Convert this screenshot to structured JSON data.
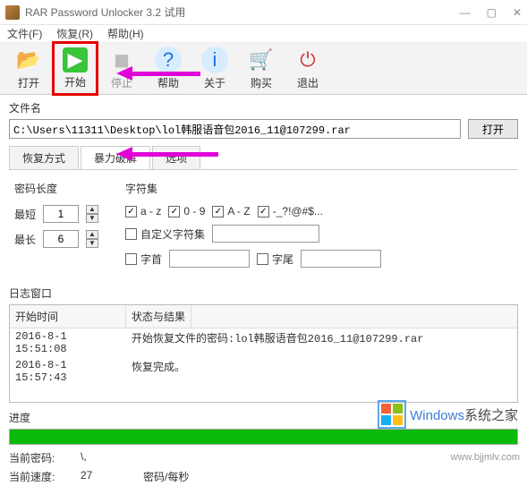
{
  "titlebar": {
    "title": "RAR Password Unlocker 3.2 试用"
  },
  "menu": {
    "file": "文件(F)",
    "restore": "恢复(R)",
    "help": "帮助(H)"
  },
  "toolbar": {
    "open": "打开",
    "start": "开始",
    "stop": "停止",
    "help": "帮助",
    "about": "关于",
    "buy": "购买",
    "exit": "退出"
  },
  "file": {
    "label": "文件名",
    "path": "C:\\Users\\11311\\Desktop\\lol韩服语音包2016_11@107299.rar",
    "open_btn": "打开"
  },
  "tabs": {
    "t1": "恢复方式",
    "t2": "暴力破解",
    "t3": "选项"
  },
  "settings": {
    "len_label": "密码长度",
    "min_label": "最短",
    "min_val": "1",
    "max_label": "最长",
    "max_val": "6",
    "charset_label": "字符集",
    "c_az": "a - z",
    "c_09": "0 - 9",
    "c_AZ": "A - Z",
    "c_sym": "-_?!@#$...",
    "custom": "自定义字符集",
    "prefix": "字首",
    "suffix": "字尾"
  },
  "log": {
    "section": "日志窗口",
    "head_time": "开始时间",
    "head_status": "状态与结果",
    "rows": [
      {
        "t": "2016-8-1 15:51:08",
        "m": "开始恢复文件的密码:lol韩服语音包2016_11@107299.rar"
      },
      {
        "t": "2016-8-1 15:57:43",
        "m": "恢复完成。"
      }
    ]
  },
  "progress": {
    "label": "进度",
    "cur_pw_label": "当前密码:",
    "cur_pw": "\\,",
    "cur_speed_label": "当前速度:",
    "cur_speed": "27",
    "speed_unit": "密码/每秒"
  },
  "watermark": {
    "win": "Windows",
    "suffix": "系统之家",
    "url": "www.bjjmlv.com"
  }
}
